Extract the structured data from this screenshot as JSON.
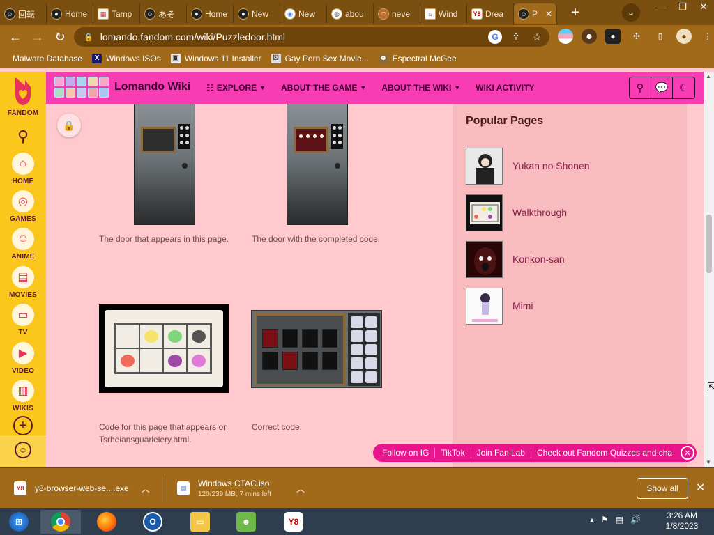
{
  "browser": {
    "tabs": [
      {
        "label": "回転",
        "icon": "anime-face-icon"
      },
      {
        "label": "Home",
        "icon": "mask-icon"
      },
      {
        "label": "Tamp",
        "icon": "image-icon"
      },
      {
        "label": "あそ",
        "icon": "anime-face-icon"
      },
      {
        "label": "Home",
        "icon": "mask-icon"
      },
      {
        "label": "New",
        "icon": "mask-icon"
      },
      {
        "label": "New",
        "icon": "chrome-icon"
      },
      {
        "label": "abou",
        "icon": "globe-icon"
      },
      {
        "label": "neve",
        "icon": "rainbow-icon"
      },
      {
        "label": "Wind",
        "icon": "museum-icon"
      },
      {
        "label": "Drea",
        "icon": "y8-icon"
      },
      {
        "label": "P",
        "icon": "anime-face-icon"
      }
    ],
    "address": "lomando.fandom.com/wiki/Puzzledoor.html",
    "bookmarks": [
      {
        "label": "Malware Database"
      },
      {
        "label": "Windows ISOs"
      },
      {
        "label": "Windows 11 Installer"
      },
      {
        "label": "Gay Porn Sex Movie..."
      },
      {
        "label": "Espectral McGee"
      }
    ]
  },
  "rail": {
    "brand": "FANDOM",
    "items": [
      {
        "label": "HOME"
      },
      {
        "label": "GAMES"
      },
      {
        "label": "ANIME"
      },
      {
        "label": "MOVIES"
      },
      {
        "label": "TV"
      },
      {
        "label": "VIDEO"
      },
      {
        "label": "WIKIS"
      }
    ]
  },
  "wiki": {
    "name": "Lomando Wiki",
    "nav": [
      {
        "label": "EXPLORE"
      },
      {
        "label": "ABOUT THE GAME"
      },
      {
        "label": "ABOUT THE WIKI"
      },
      {
        "label": "WIKI ACTIVITY"
      }
    ]
  },
  "gallery": {
    "captions": [
      "The door that appears in this page.",
      "The door with the completed code.",
      "Code for this page that appears on Tsrheiansguarlelery.html.",
      "Correct code."
    ]
  },
  "sidebar": {
    "title": "Popular Pages",
    "pages": [
      {
        "label": "Yukan no Shonen"
      },
      {
        "label": "Walkthrough"
      },
      {
        "label": "Konkon-san"
      },
      {
        "label": "Mimi"
      }
    ]
  },
  "social": {
    "links": [
      "Follow on IG",
      "TikTok",
      "Join Fan Lab",
      "Check out Fandom Quizzes and cha"
    ]
  },
  "downloads": [
    {
      "name": "y8-browser-web-se....exe",
      "status": ""
    },
    {
      "name": "Windows CTAC.iso",
      "status": "120/239 MB, 7 mins left"
    }
  ],
  "shelf": {
    "show_all": "Show all"
  },
  "clock": {
    "time": "3:26 AM",
    "date": "1/8/2023"
  },
  "colors": {
    "wiki_header": "#f73cb4",
    "rail": "#fbc71c",
    "page_bg": "#ffc9cd",
    "link": "#8a1f4d"
  }
}
